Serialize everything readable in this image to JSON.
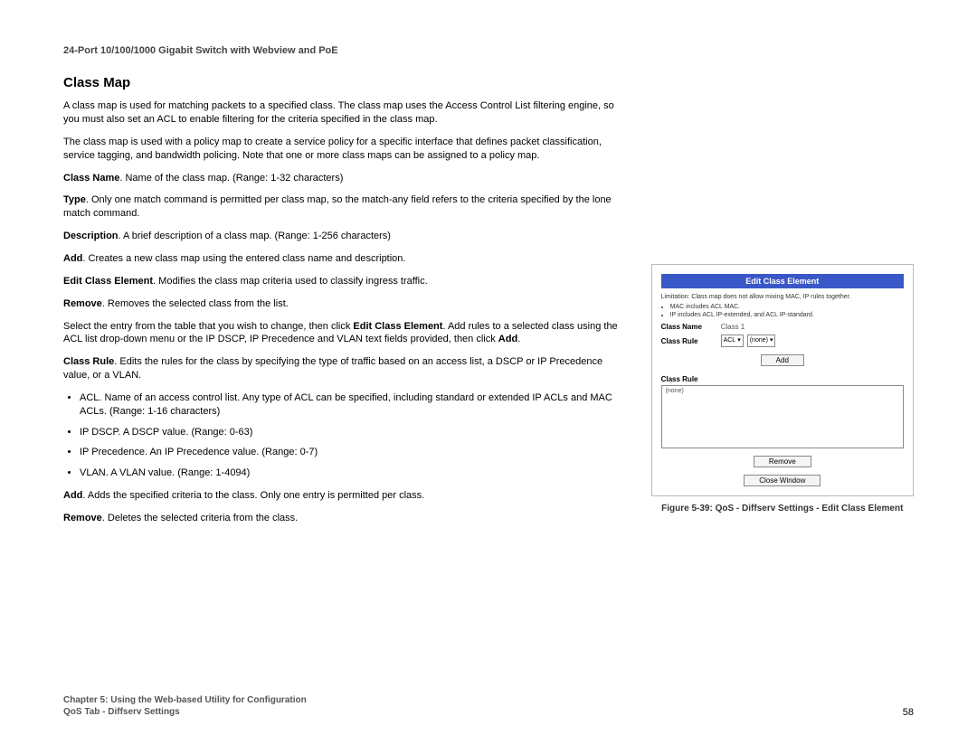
{
  "header": "24-Port 10/100/1000 Gigabit Switch with Webview and PoE",
  "title": "Class Map",
  "p_intro1": "A class map is used for matching packets to a specified class. The class map uses the Access Control List filtering engine, so you must also set an ACL to enable filtering for the criteria specified in the class map.",
  "p_intro2": "The class map is used with a policy map to create a service policy for a specific interface that defines packet classification, service tagging, and bandwidth policing. Note that one or more class maps can be assigned to a policy map.",
  "cn_b": "Class Name",
  "cn_t": ". Name of the class map. (Range: 1-32 characters)",
  "ty_b": "Type",
  "ty_t": ". Only one match command is permitted per class map, so the match-any field refers to the criteria specified by the lone match command.",
  "de_b": "Description",
  "de_t": ". A brief description of a class map. (Range: 1-256 characters)",
  "ad_b": "Add",
  "ad_t": ". Creates a new class map using the entered class name and description.",
  "ec_b": "Edit Class Element",
  "ec_t": ". Modifies the class map criteria used to classify ingress traffic.",
  "rm_b": "Remove",
  "rm_t": ". Removes the selected class from the list.",
  "sel_t1": "Select the entry from the table that you wish to change, then click ",
  "sel_b1": "Edit Class Element",
  "sel_t2": ". Add rules to a selected class using the ACL list drop-down menu or the IP DSCP, IP Precedence and VLAN text fields provided, then click ",
  "sel_b2": "Add",
  "sel_t3": ".",
  "cr_b": "Class Rule",
  "cr_t": ". Edits the rules for the class by specifying the type of traffic based on an access list, a DSCP or IP Precedence value, or a VLAN.",
  "li_acl": "ACL. Name of an access control list. Any type of ACL can be specified, including standard or extended IP ACLs and MAC ACLs. (Range: 1-16 characters)",
  "li_dscp": "IP DSCP. A DSCP value. (Range: 0-63)",
  "li_prec": "IP Precedence. An IP Precedence value. (Range: 0-7)",
  "li_vlan": "VLAN. A VLAN value. (Range: 1-4094)",
  "ad2_b": "Add",
  "ad2_t": ". Adds the specified criteria to the class. Only one entry is permitted per class.",
  "rm2_b": "Remove",
  "rm2_t": ". Deletes the selected criteria from the class.",
  "fig": {
    "title": "Edit Class Element",
    "limit": "Limitation: Class map does not allow mixing MAC, IP rules together.",
    "lim_a": "MAC includes ACL MAC.",
    "lim_b": "IP includes ACL IP-extended, and ACL IP-standard.",
    "name_label": "Class Name",
    "name_value": "Class 1",
    "rule_label": "Class Rule",
    "acl_opt": "ACL",
    "none_opt": "(none)",
    "add_btn": "Add",
    "rulebox_label": "Class Rule",
    "rulebox_value": "(none)",
    "remove_btn": "Remove",
    "close_btn": "Close Window"
  },
  "caption": "Figure 5-39: QoS - Diffserv Settings - Edit Class Element",
  "footer_line1": "Chapter 5: Using the Web-based Utility for Configuration",
  "footer_line2": "QoS Tab - Diffserv Settings",
  "page_num": "58"
}
